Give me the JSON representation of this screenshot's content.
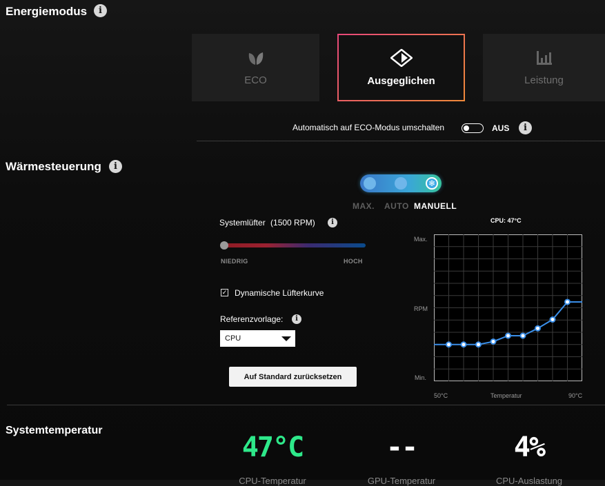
{
  "power": {
    "title": "Energiemodus",
    "modes": [
      {
        "label": "ECO",
        "icon": "leaf-icon",
        "active": false
      },
      {
        "label": "Ausgeglichen",
        "icon": "balanced-diamond-icon",
        "active": true
      },
      {
        "label": "Leistung",
        "icon": "performance-bars-icon",
        "active": false
      }
    ],
    "auto_eco_label": "Automatisch auf ECO-Modus umschalten",
    "auto_eco_state": "AUS"
  },
  "thermal": {
    "title": "Wärmesteuerung",
    "fan_modes": [
      "MAX.",
      "AUTO",
      "MANUELL"
    ],
    "selected_fan_mode": "MANUELL",
    "system_fan_label": "Systemlüfter",
    "system_fan_rpm": "(1500 RPM)",
    "slider_value": 0,
    "slider_low": "NIEDRIG",
    "slider_high": "HOCH",
    "dynamic_curve_label": "Dynamische Lüfterkurve",
    "dynamic_curve_checked": true,
    "reference_label": "Referenzvorlage:",
    "reference_value": "CPU",
    "reset_label": "Auf Standard zurücksetzen"
  },
  "chart_data": {
    "type": "line",
    "title": "CPU: 47°C",
    "ylabel": "RPM",
    "y_top_label": "Max.",
    "y_bottom_label": "Min.",
    "xlabel": "Temperatur",
    "x_start_label": "50°C",
    "x_end_label": "90°C",
    "xlim": [
      50,
      90
    ],
    "ylim": [
      0,
      100
    ],
    "grid": true,
    "series": [
      {
        "x": [
          50,
          54,
          58,
          62,
          66,
          70,
          74,
          78,
          82,
          86,
          90
        ],
        "values": [
          25,
          25,
          25,
          25,
          27,
          31,
          31,
          36,
          42,
          54,
          54
        ]
      }
    ],
    "line_color": "#3a8ee8"
  },
  "system_temp": {
    "title": "Systemtemperatur",
    "readings": [
      {
        "value": "47°C",
        "label": "CPU-Temperatur",
        "color": "#2ee88a"
      },
      {
        "value": "--",
        "label": "GPU-Temperatur",
        "color": "#ffffff"
      },
      {
        "value": "4%",
        "label": "CPU-Auslastung",
        "color": "#ffffff"
      }
    ]
  }
}
